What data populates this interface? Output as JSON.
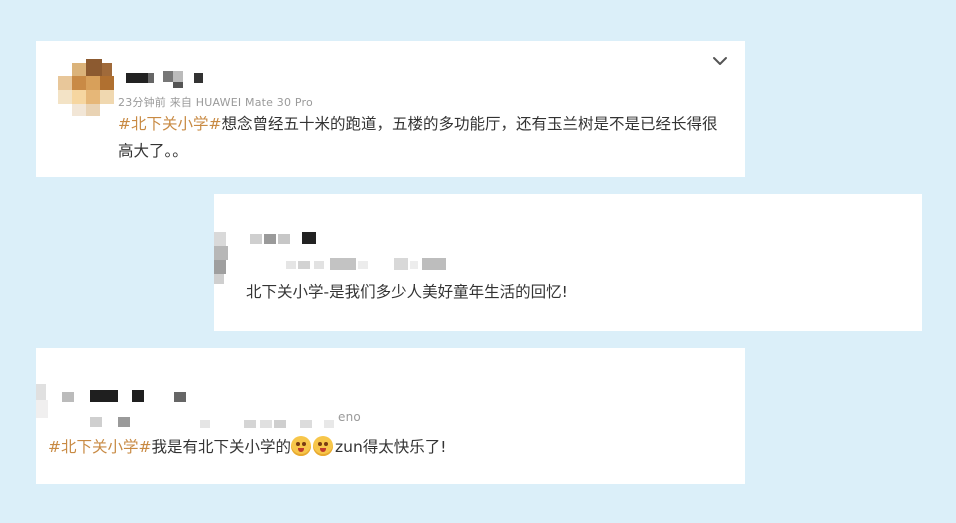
{
  "posts": [
    {
      "meta": "23分钟前  来自 HUAWEI Mate 30 Pro",
      "hashtag": "#北下关小学#",
      "text_line1": "想念曾经五十米的跑道，五楼的多功能厅，还有玉兰树是不是已经长得很",
      "text_line2": "高大了。。"
    },
    {
      "meta": "",
      "text": "北下关小学-是我们多少人美好童年生活的回忆!"
    },
    {
      "meta": "eno",
      "hashtag": "#北下关小学#",
      "text_part1": "我是有北下关小学的",
      "text_part2": "zun得太快乐了!"
    }
  ],
  "icons": [
    "chevron-down-icon",
    "emoji-icon"
  ]
}
